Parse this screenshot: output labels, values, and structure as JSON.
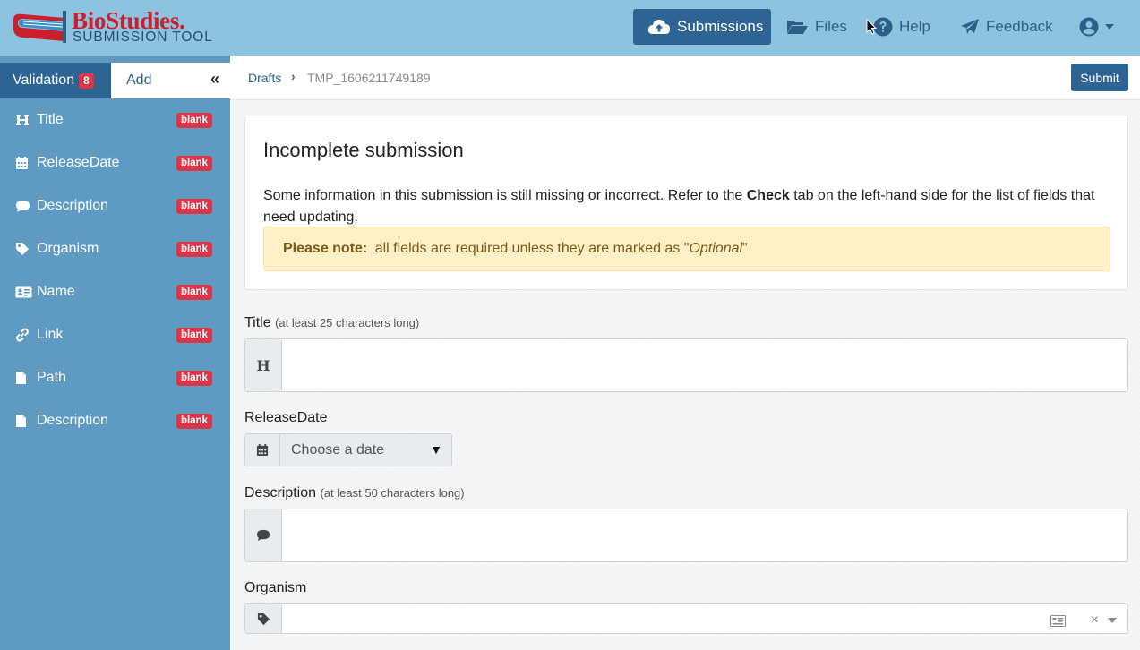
{
  "brand": {
    "name": "BioStudies.",
    "subtitle": "SUBMISSION TOOL"
  },
  "nav": {
    "submissions": "Submissions",
    "files": "Files",
    "help": "Help",
    "feedback": "Feedback"
  },
  "sidebar": {
    "tab_validation": "Validation",
    "validation_count": "8",
    "tab_add": "Add",
    "collapse_glyph": "«",
    "items": [
      {
        "label": "Title",
        "icon": "heading-icon",
        "badge": "blank"
      },
      {
        "label": "ReleaseDate",
        "icon": "calendar-icon",
        "badge": "blank"
      },
      {
        "label": "Description",
        "icon": "comment-icon",
        "badge": "blank"
      },
      {
        "label": "Organism",
        "icon": "tag-icon",
        "badge": "blank"
      },
      {
        "label": "Name",
        "icon": "id-card-icon",
        "badge": "blank"
      },
      {
        "label": "Link",
        "icon": "link-icon",
        "badge": "blank"
      },
      {
        "label": "Path",
        "icon": "file-icon",
        "badge": "blank"
      },
      {
        "label": "Description",
        "icon": "file-icon",
        "badge": "blank"
      }
    ]
  },
  "breadcrumb": {
    "drafts": "Drafts",
    "separator": "›",
    "current": "TMP_1606211749189"
  },
  "submit_label": "Submit",
  "card": {
    "title": "Incomplete submission",
    "text_before": "Some information in this submission is still missing or incorrect. Refer to the ",
    "text_bold": "Check",
    "text_after": " tab on the left-hand side for the list of fields that need updating.",
    "note_bold": "Please note:",
    "note_text": " all fields are required unless they are marked as \"",
    "note_italic": "Optional",
    "note_end": "\""
  },
  "fields": {
    "title_label": "Title",
    "title_hint": "(at least 25 characters long)",
    "title_addon": "H",
    "release_label": "ReleaseDate",
    "release_placeholder": "Choose a date",
    "release_caret": "▼",
    "description_label": "Description",
    "description_hint": "(at least 50 characters long)",
    "organism_label": "Organism",
    "organism_clear": "×"
  },
  "colors": {
    "navbar": "#8ec3e0",
    "primary": "#2d6494",
    "sidebar": "#5f9ac2",
    "danger": "#dc3545",
    "note_bg": "#fff0c7"
  }
}
